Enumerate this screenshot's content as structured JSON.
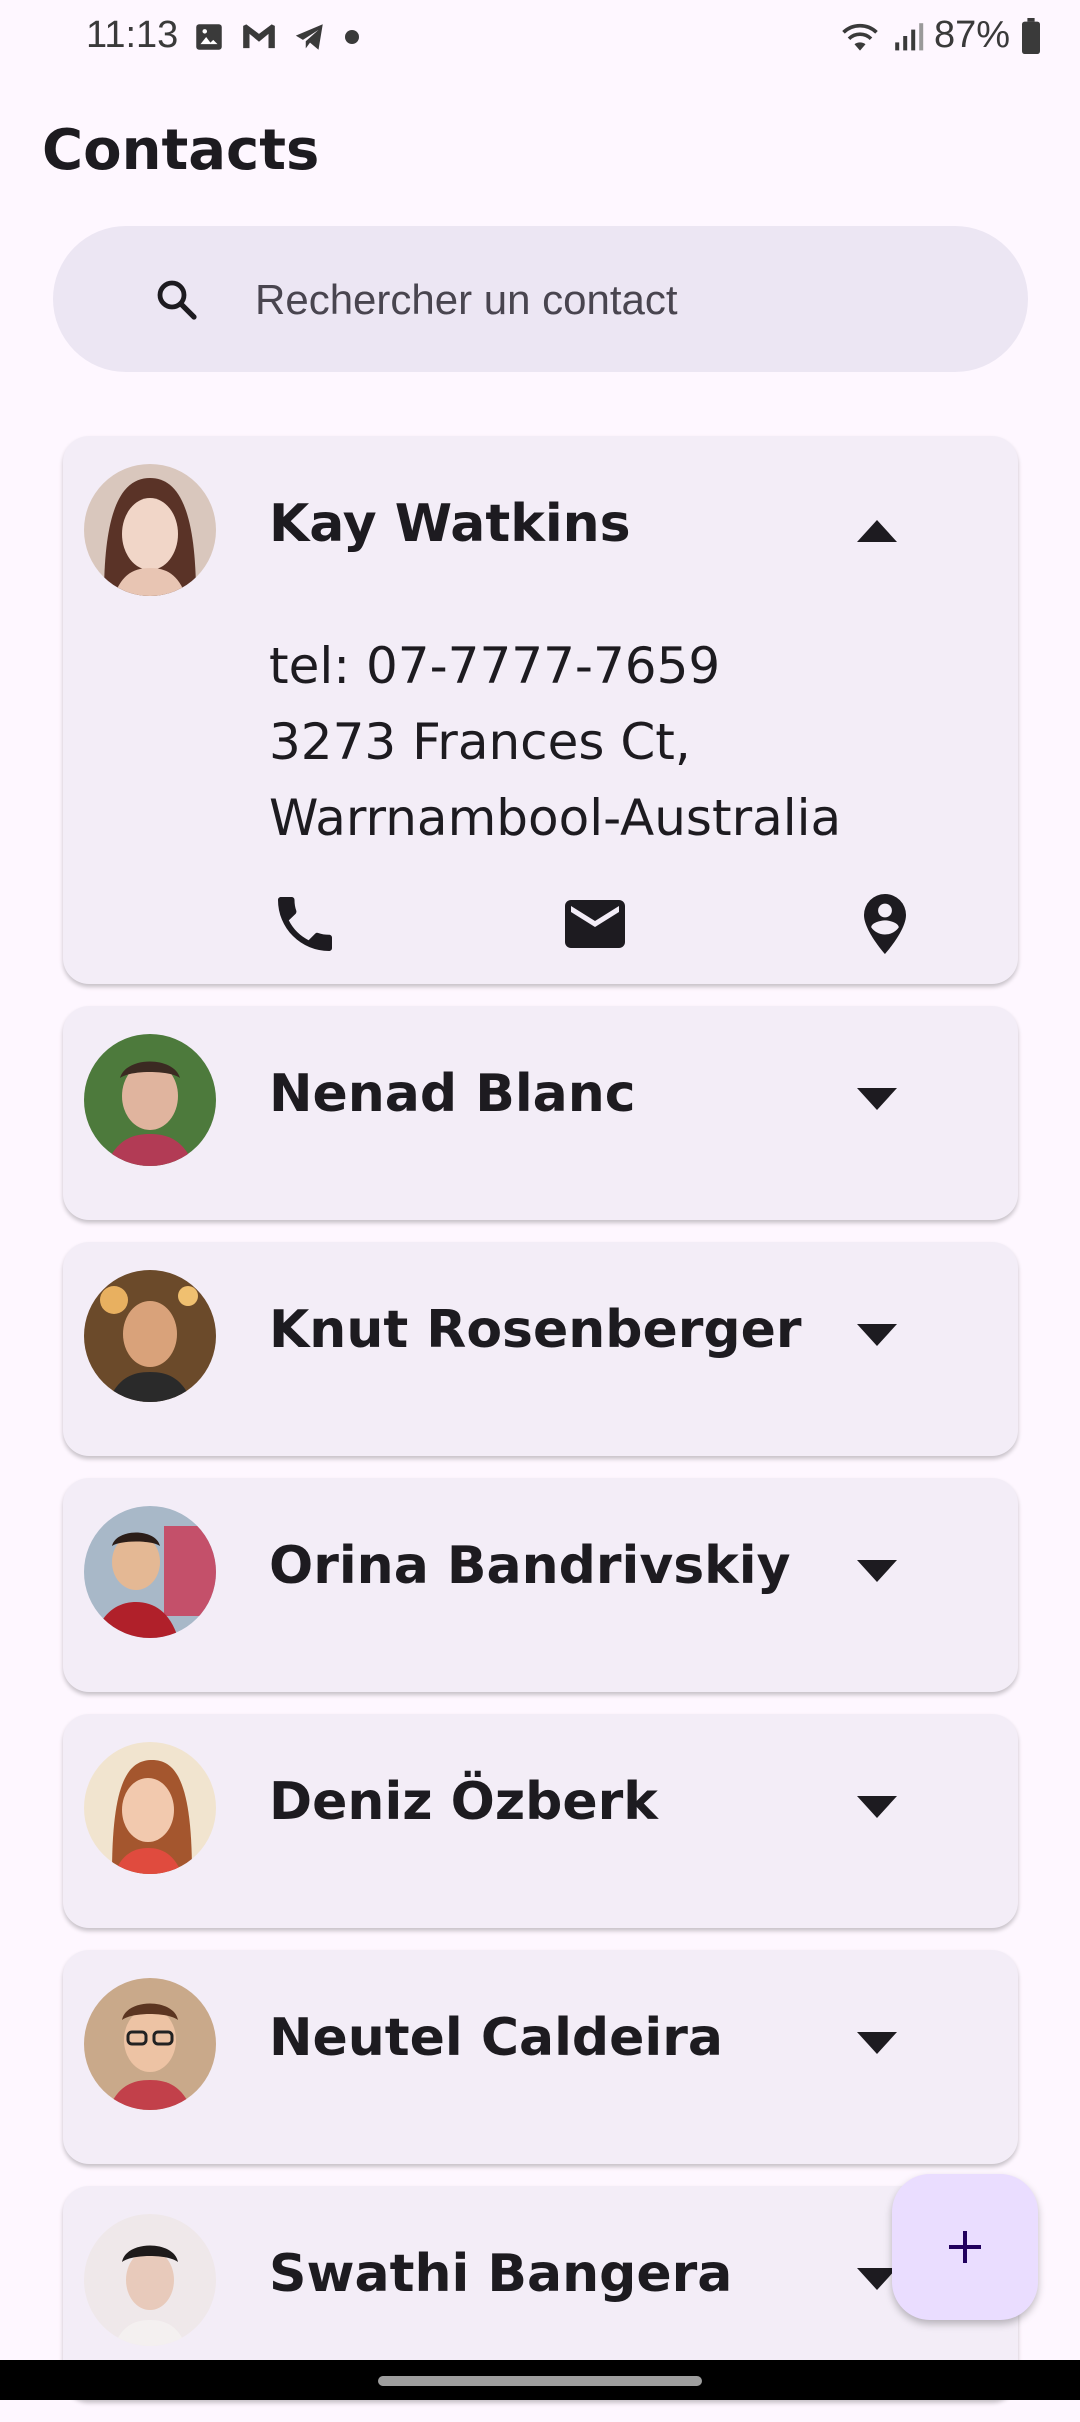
{
  "status_bar": {
    "time": "11:13",
    "battery": "87%",
    "left_icons": [
      "gallery-icon",
      "gmail-icon",
      "telegram-icon",
      "dot-icon"
    ],
    "right_icons": [
      "wifi-icon",
      "signal-icon",
      "battery-icon"
    ]
  },
  "header": {
    "title": "Contacts"
  },
  "search": {
    "placeholder": "Rechercher un contact"
  },
  "contacts": [
    {
      "name": "Kay Watkins",
      "expanded": true,
      "phone": "tel: 07-7777-7659",
      "address_line1": "3273 Frances Ct,",
      "address_line2": "Warrnambool-Australia",
      "actions": [
        "phone-icon",
        "email-icon",
        "location-icon"
      ]
    },
    {
      "name": "Nenad Blanc",
      "expanded": false
    },
    {
      "name": "Knut Rosenberger",
      "expanded": false
    },
    {
      "name": "Orina Bandrivskiy",
      "expanded": false
    },
    {
      "name": "Deniz Özberk",
      "expanded": false
    },
    {
      "name": "Neutel Caldeira",
      "expanded": false
    },
    {
      "name": "Swathi Bangera",
      "expanded": false
    }
  ],
  "fab": {
    "icon": "plus-icon"
  },
  "colors": {
    "background": "#fef7ff",
    "card": "#f3edf7",
    "search": "#ece6f3",
    "fab": "#eaddff",
    "text": "#1d1b20"
  }
}
